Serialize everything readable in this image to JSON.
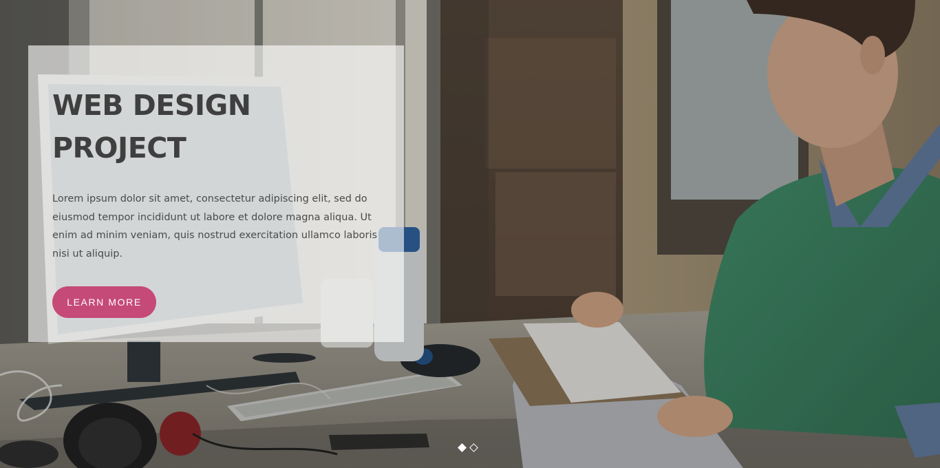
{
  "slider": {
    "slide": {
      "title": "WEB DESIGN PROJECT",
      "text": "Lorem ipsum dolor sit amet, consectetur adipiscing elit, sed do eiusmod tempor incididunt ut labore et dolore magna aliqua. Ut enim ad minim veniam, quis nostrud exercitation ullamco laboris nisi ut aliquip.",
      "button_label": "LEARN MORE"
    },
    "dots": [
      {
        "active": true
      },
      {
        "active": false
      }
    ]
  },
  "colors": {
    "button": "#c54a78",
    "title": "#3f3f3f",
    "text": "#4a4a4a",
    "overlay": "#ffffff"
  }
}
